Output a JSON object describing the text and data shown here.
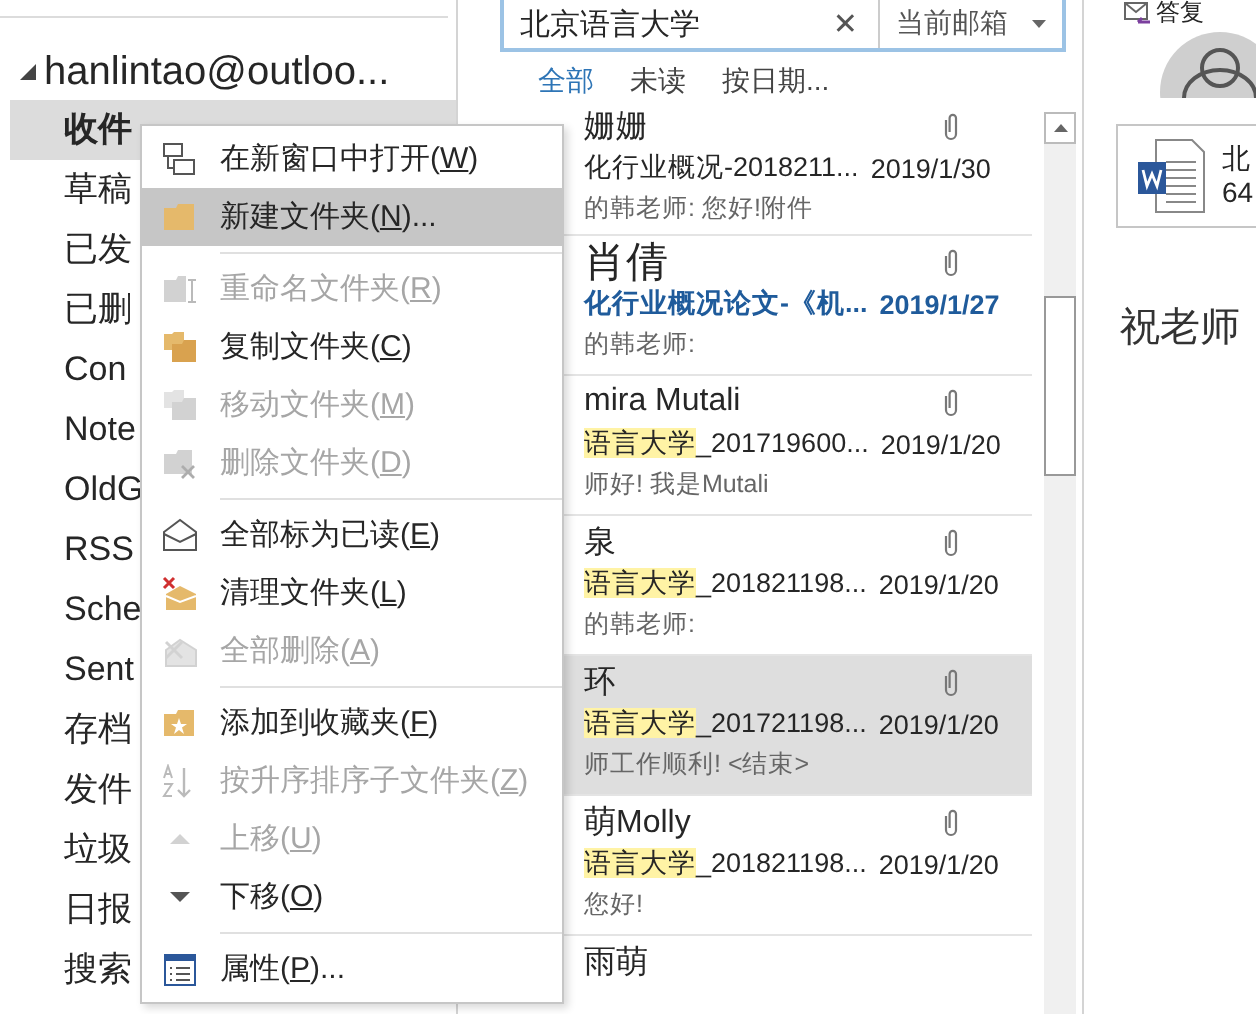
{
  "account": {
    "name": "hanlintao@outloo...",
    "expanded": true
  },
  "folders": [
    {
      "name": "收件",
      "selected": true
    },
    {
      "name": "草稿",
      "selected": false
    },
    {
      "name": "已发",
      "selected": false
    },
    {
      "name": "已删",
      "selected": false
    },
    {
      "name": "Con",
      "selected": false
    },
    {
      "name": "Note",
      "selected": false
    },
    {
      "name": "OldG",
      "selected": false
    },
    {
      "name": "RSS",
      "selected": false
    },
    {
      "name": "Sche",
      "selected": false
    },
    {
      "name": "Sent",
      "selected": false
    },
    {
      "name": "存档",
      "selected": false
    },
    {
      "name": "发件",
      "selected": false
    },
    {
      "name": "垃圾",
      "selected": false
    },
    {
      "name": "日报",
      "selected": false
    },
    {
      "name": "搜索",
      "selected": false
    }
  ],
  "search": {
    "value": "北京语言大学",
    "clear": "✕",
    "scope": "当前邮箱"
  },
  "tabs": [
    {
      "label": "全部",
      "selected": true
    },
    {
      "label": "未读",
      "selected": false
    },
    {
      "label": "按日期...",
      "selected": false
    }
  ],
  "messages": [
    {
      "sender": "姗姗",
      "unread": false,
      "selected": false,
      "attachment": true,
      "subject": [
        {
          "text": "化行业概况-2018211...",
          "highlighted": false
        }
      ],
      "date": "2019/1/30",
      "preview": "的韩老师:   您好!附件"
    },
    {
      "sender": "肖倩",
      "unread": true,
      "selected": false,
      "attachment": true,
      "subject": [
        {
          "text": "化行业概况论文-《机...",
          "highlighted": false
        }
      ],
      "date": "2019/1/27",
      "preview": "的韩老师:"
    },
    {
      "sender": "mira Mutali",
      "unread": false,
      "selected": false,
      "attachment": true,
      "subject": [
        {
          "text": "语言大学",
          "highlighted": true
        },
        {
          "text": "_201719600...",
          "highlighted": false
        }
      ],
      "date": "2019/1/20",
      "preview": "师好!   我是Mutali"
    },
    {
      "sender": "泉",
      "unread": false,
      "selected": false,
      "attachment": true,
      "subject": [
        {
          "text": "语言大学",
          "highlighted": true
        },
        {
          "text": "_201821198...",
          "highlighted": false
        }
      ],
      "date": "2019/1/20",
      "preview": "的韩老师:"
    },
    {
      "sender": "环",
      "unread": false,
      "selected": true,
      "attachment": true,
      "subject": [
        {
          "text": "语言大学",
          "highlighted": true
        },
        {
          "text": "_201721198...",
          "highlighted": false
        }
      ],
      "date": "2019/1/20",
      "preview": "师工作顺利! <结束>"
    },
    {
      "sender": "萌Molly",
      "unread": false,
      "selected": false,
      "attachment": true,
      "subject": [
        {
          "text": "语言大学",
          "highlighted": true
        },
        {
          "text": "_201821198...",
          "highlighted": false
        }
      ],
      "date": "2019/1/20",
      "preview": "您好!"
    },
    {
      "sender": "雨萌",
      "unread": false,
      "selected": false,
      "attachment": false
    }
  ],
  "menu": {
    "items": [
      {
        "before": "在新窗口中打开(",
        "key": "W",
        "after": ")",
        "disabled": false,
        "highlighted": false,
        "separator_after": false
      },
      {
        "before": "新建文件夹(",
        "key": "N",
        "after": ")...",
        "disabled": false,
        "highlighted": true,
        "separator_after": true
      },
      {
        "before": "重命名文件夹(",
        "key": "R",
        "after": ")",
        "disabled": true,
        "highlighted": false,
        "separator_after": false
      },
      {
        "before": "复制文件夹(",
        "key": "C",
        "after": ")",
        "disabled": false,
        "highlighted": false,
        "separator_after": false
      },
      {
        "before": "移动文件夹(",
        "key": "M",
        "after": ")",
        "disabled": true,
        "highlighted": false,
        "separator_after": false
      },
      {
        "before": "删除文件夹(",
        "key": "D",
        "after": ")",
        "disabled": true,
        "highlighted": false,
        "separator_after": true
      },
      {
        "before": "全部标为已读(",
        "key": "E",
        "after": ")",
        "disabled": false,
        "highlighted": false,
        "separator_after": false
      },
      {
        "before": "清理文件夹(",
        "key": "L",
        "after": ")",
        "disabled": false,
        "highlighted": false,
        "separator_after": false
      },
      {
        "before": "全部删除(",
        "key": "A",
        "after": ")",
        "disabled": true,
        "highlighted": false,
        "separator_after": true
      },
      {
        "before": "添加到收藏夹(",
        "key": "F",
        "after": ")",
        "disabled": false,
        "highlighted": false,
        "separator_after": false
      },
      {
        "before": "按升序排序子文件夹(",
        "key": "Z",
        "after": ")",
        "disabled": true,
        "highlighted": false,
        "separator_after": false
      },
      {
        "before": "上移(",
        "key": "U",
        "after": ")",
        "disabled": true,
        "highlighted": false,
        "separator_after": false
      },
      {
        "before": "下移(",
        "key": "O",
        "after": ")",
        "disabled": false,
        "highlighted": false,
        "separator_after": true
      },
      {
        "before": "属性(",
        "key": "P",
        "after": ")...",
        "disabled": false,
        "highlighted": false,
        "separator_after": false
      }
    ]
  },
  "reading": {
    "reply": "答复",
    "attachment_name": "北",
    "attachment_size": "64",
    "body": "祝老师"
  }
}
